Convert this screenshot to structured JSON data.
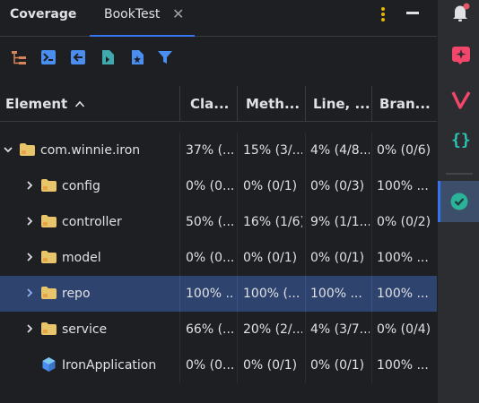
{
  "header": {
    "title": "Coverage",
    "tab_label": "BookTest",
    "tab_close": "✕"
  },
  "toolbar": {
    "icons": [
      "hierarchy-icon",
      "run-with-coverage-icon",
      "import-coverage-icon",
      "export-report-icon",
      "generate-report-icon",
      "filter-icon"
    ]
  },
  "table": {
    "columns": [
      "Element",
      "Cla...",
      "Meth...",
      "Line, ...",
      "Bran..."
    ],
    "sort_indicator": "^",
    "rows": [
      {
        "name": "com.winnie.iron",
        "type": "package",
        "expandable": true,
        "expanded": true,
        "indent": 0,
        "cls": "37% (...",
        "meth": "15% (3/...",
        "line": "4% (4/8...",
        "branch": "0% (0/6)"
      },
      {
        "name": "config",
        "type": "package",
        "expandable": true,
        "expanded": false,
        "indent": 1,
        "cls": "0% (0...",
        "meth": "0% (0/1)",
        "line": "0% (0/3)",
        "branch": "100% ..."
      },
      {
        "name": "controller",
        "type": "package",
        "expandable": true,
        "expanded": false,
        "indent": 1,
        "cls": "50% (...",
        "meth": "16% (1/6)",
        "line": "9% (1/1...",
        "branch": "0% (0/2)"
      },
      {
        "name": "model",
        "type": "package",
        "expandable": true,
        "expanded": false,
        "indent": 1,
        "cls": "0% (0...",
        "meth": "0% (0/1)",
        "line": "0% (0/1)",
        "branch": "100% ..."
      },
      {
        "name": "repo",
        "type": "package",
        "expandable": true,
        "expanded": false,
        "indent": 1,
        "selected": true,
        "cls": "100% ...",
        "meth": "100% (...",
        "line": "100% ...",
        "branch": "100% ..."
      },
      {
        "name": "service",
        "type": "package",
        "expandable": true,
        "expanded": false,
        "indent": 1,
        "cls": "66% (...",
        "meth": "20% (2/...",
        "line": "4% (3/7...",
        "branch": "0% (0/4)"
      },
      {
        "name": "IronApplication",
        "type": "class",
        "expandable": false,
        "indent": 1,
        "cls": "0% (0...",
        "meth": "0% (0/1)",
        "line": "0% (0/1)",
        "branch": "100% ..."
      }
    ]
  },
  "right_sidebar": {
    "icons": [
      "notifications-icon",
      "ai-assistant-icon",
      "vuejs-icon",
      "json-icon",
      "coverage-icon"
    ]
  },
  "colors": {
    "background": "#1e1f22",
    "selected_row": "#2e436e",
    "accent": "#3574f0",
    "folder": "#e8c56a",
    "toolbar_teal": "#3fa9ad",
    "toolbar_blue": "#4a8ff0",
    "kebab": "#e8b600"
  }
}
